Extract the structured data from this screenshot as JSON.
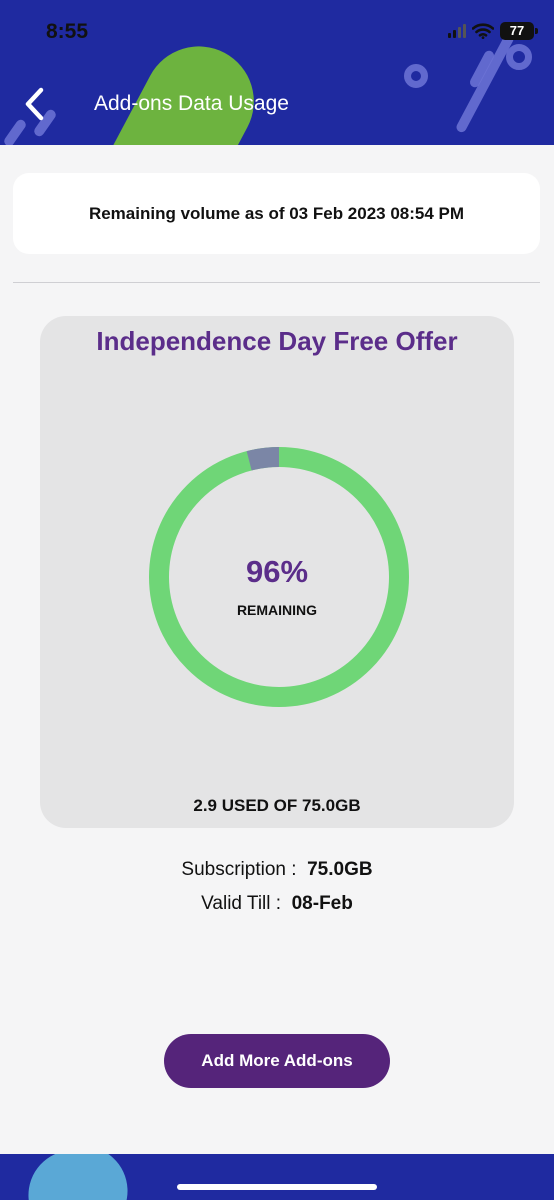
{
  "status_bar": {
    "time": "8:55",
    "battery": "77"
  },
  "header": {
    "title": "Add-ons Data Usage"
  },
  "info_card": {
    "text": "Remaining volume as of 03 Feb 2023 08:54 PM"
  },
  "offer": {
    "title": "Independence Day Free Offer",
    "percent_text": "96%",
    "percent_label": "REMAINING",
    "remaining_fraction": 0.96,
    "used_text": "2.9 USED OF 75.0GB"
  },
  "details": {
    "subscription_label": "Subscription :",
    "subscription_value": "75.0GB",
    "valid_label": "Valid Till :",
    "valid_value": "08-Feb"
  },
  "actions": {
    "add_more_label": "Add More Add-ons"
  },
  "colors": {
    "header_bg": "#1f2aa0",
    "accent_purple": "#5b2d8a",
    "button_bg": "#55247a",
    "donut_remaining": "#6fd677",
    "donut_used": "#7b86a6"
  }
}
